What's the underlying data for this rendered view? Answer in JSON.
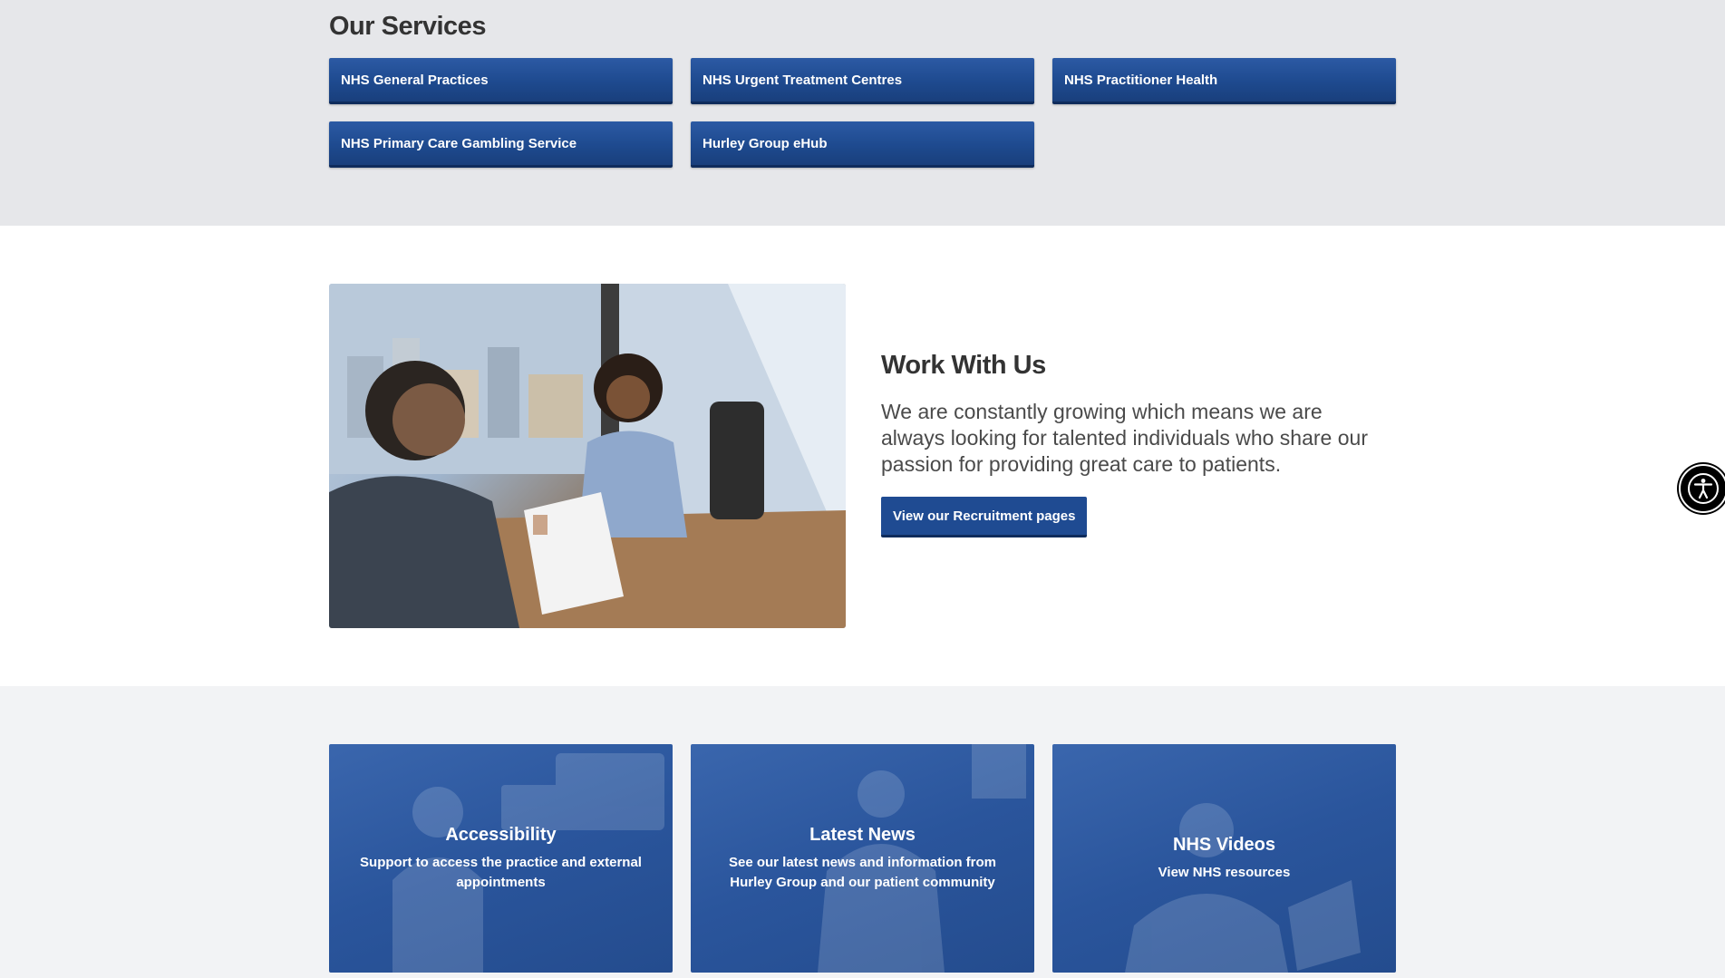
{
  "services": {
    "heading": "Our Services",
    "items": [
      {
        "label": "NHS General Practices"
      },
      {
        "label": "NHS Urgent Treatment Centres"
      },
      {
        "label": "NHS Practitioner Health"
      },
      {
        "label": "NHS Primary Care Gambling Service"
      },
      {
        "label": "Hurley Group eHub"
      }
    ]
  },
  "work": {
    "heading": "Work With Us",
    "body": "We are constantly growing which means we are always looking for talented individuals who share our passion for providing great care to patients.",
    "button_label": "View our Recruitment pages"
  },
  "features": [
    {
      "title": "Accessibility",
      "description": "Support to access the practice and external appointments"
    },
    {
      "title": "Latest News",
      "description": "See our latest news and information from Hurley Group and our patient community"
    },
    {
      "title": "NHS Videos",
      "description": "View NHS resources"
    }
  ],
  "colors": {
    "nhs_blue": "#1f4b92",
    "services_bg": "#e6e7ea",
    "features_bg": "#f2f3f5"
  },
  "icons": {
    "accessibility_widget": "accessibility-person-icon"
  }
}
